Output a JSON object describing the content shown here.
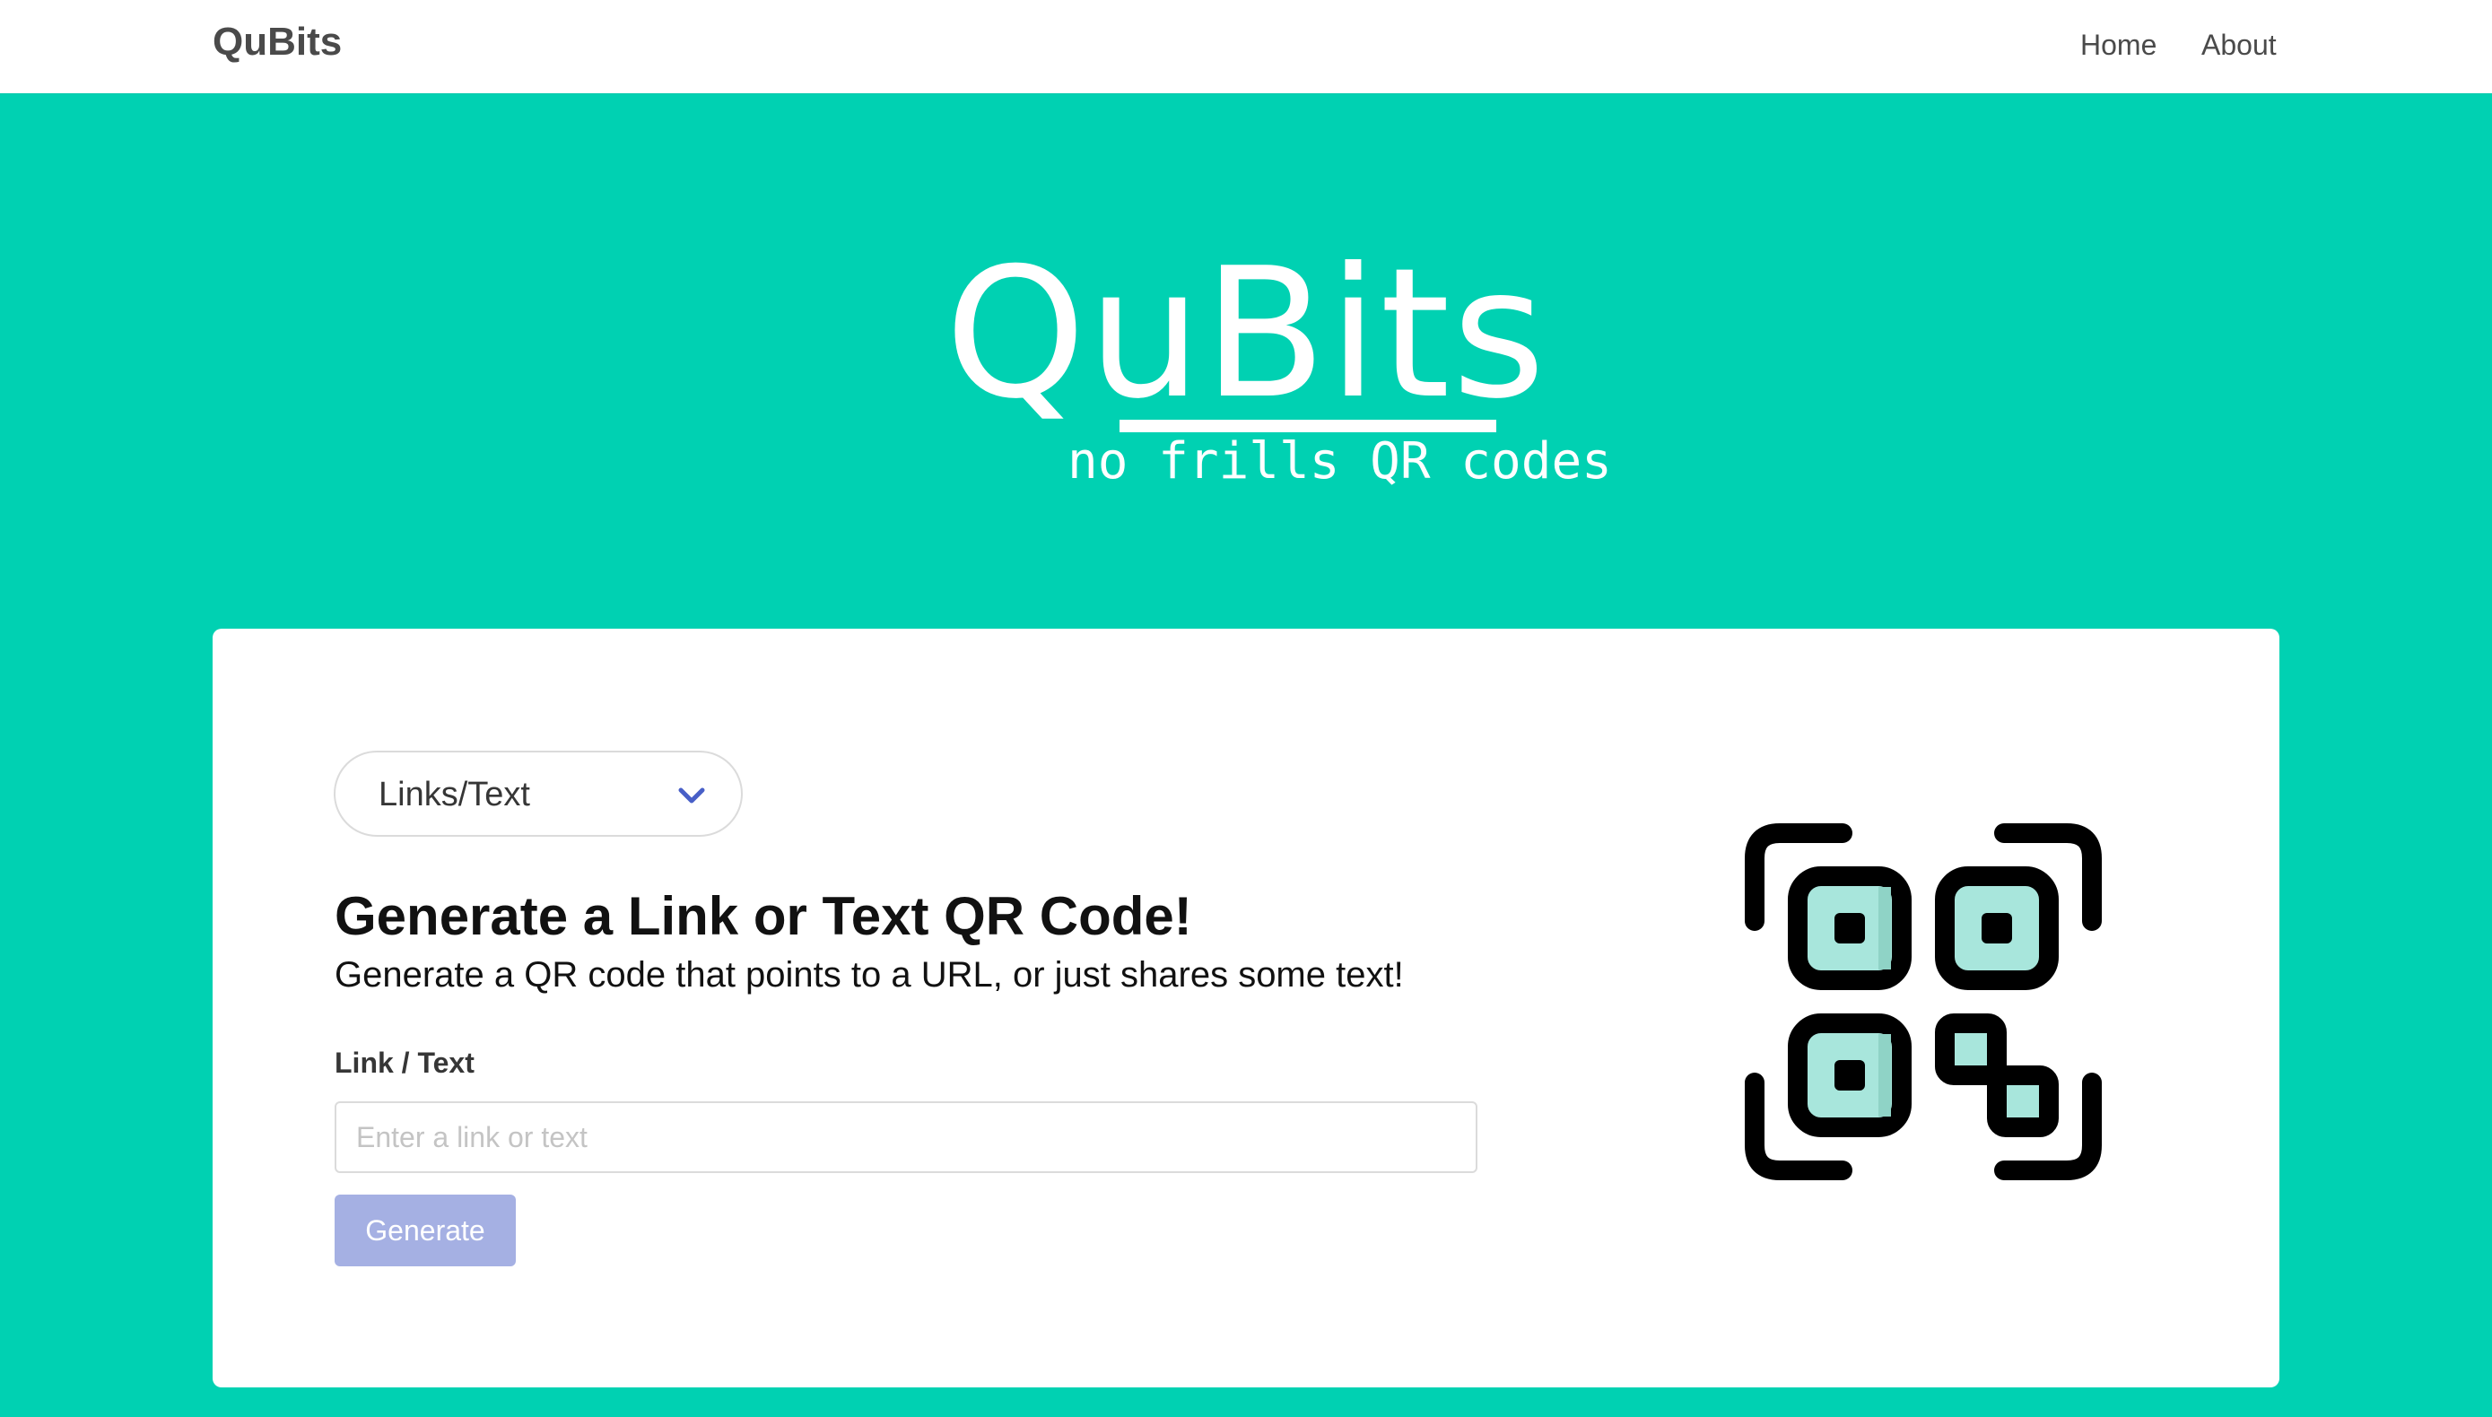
{
  "navbar": {
    "brand": "QuBits",
    "links": [
      {
        "label": "Home"
      },
      {
        "label": "About"
      }
    ]
  },
  "hero": {
    "title": "QuBits",
    "subtitle": "no frills QR codes"
  },
  "form": {
    "type_select": {
      "selected": "Links/Text",
      "icon": "chevron-down-icon"
    },
    "title": "Generate a Link or Text QR Code!",
    "subtitle": "Generate a QR code that points to a URL, or just shares some text!",
    "field_label": "Link / Text",
    "input_value": "",
    "input_placeholder": "Enter a link or text",
    "button_label": "Generate",
    "illustration": "qr-code-icon"
  },
  "colors": {
    "hero_bg": "#00d1b2",
    "button_bg": "#a5b0e3",
    "chevron": "#485fc7",
    "qr_fill": "#a8e6dc"
  }
}
